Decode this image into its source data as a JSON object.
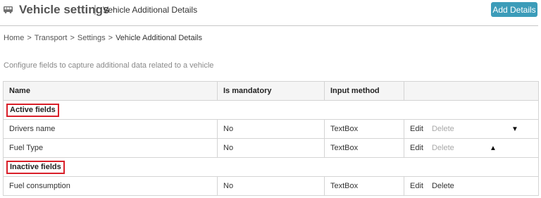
{
  "header": {
    "icon": "bus-icon",
    "title": "Vehicle settings",
    "separator": "|",
    "subtitle": "Vehicle Additional Details",
    "add_button_label": "Add Details",
    "accent_color": "#3c9cb9"
  },
  "breadcrumb": {
    "items": [
      "Home",
      "Transport",
      "Settings",
      "Vehicle Additional Details"
    ],
    "separator": ">"
  },
  "description": "Configure fields to capture additional data related to a vehicle",
  "table": {
    "columns": [
      "Name",
      "Is mandatory",
      "Input method",
      ""
    ],
    "active_label": "Active fields",
    "inactive_label": "Inactive fields",
    "section_highlight_color": "#d9202a",
    "active_rows": [
      {
        "name": "Drivers name",
        "mandatory": "No",
        "input_method": "TextBox",
        "edit": "Edit",
        "delete": "Delete",
        "arrow": "▼"
      },
      {
        "name": "Fuel Type",
        "mandatory": "No",
        "input_method": "TextBox",
        "edit": "Edit",
        "delete": "Delete",
        "arrow": "▲"
      }
    ],
    "inactive_rows": [
      {
        "name": "Fuel consumption",
        "mandatory": "No",
        "input_method": "TextBox",
        "edit": "Edit",
        "delete": "Delete"
      }
    ]
  }
}
